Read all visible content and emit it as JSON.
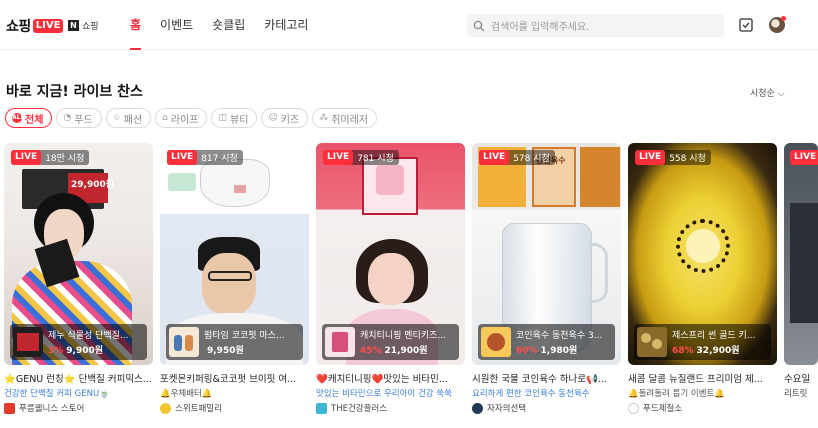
{
  "header": {
    "logo_text": "쇼핑",
    "logo_live": "LIVE",
    "naver_mark": "N",
    "naver_label": "쇼핑",
    "nav": [
      "홈",
      "이벤트",
      "숏클립",
      "카테고리"
    ],
    "search_placeholder": "검색어를 입력해주세요."
  },
  "section": {
    "title": "바로 지금! 라이브 찬스",
    "sort_label": "시청순",
    "chips": [
      {
        "label": "전체",
        "icon": "all-icon",
        "glyph": "ALL"
      },
      {
        "label": "푸드",
        "icon": "food-icon",
        "glyph": "◔"
      },
      {
        "label": "패션",
        "icon": "fashion-icon",
        "glyph": "♧"
      },
      {
        "label": "라이프",
        "icon": "home-icon",
        "glyph": "⌂"
      },
      {
        "label": "뷰티",
        "icon": "beauty-icon",
        "glyph": "◫"
      },
      {
        "label": "키즈",
        "icon": "kids-icon",
        "glyph": "☺"
      },
      {
        "label": "취미레저",
        "icon": "hobby-icon",
        "glyph": "⁂"
      }
    ]
  },
  "cards": [
    {
      "live": "LIVE",
      "viewers": "18만 시청",
      "product_name": "제누 식물성 단백질...",
      "discount": "",
      "price": "9,900원",
      "title": "⭐GENU 런칭⭐ 단백질 커피믹스...",
      "subtitle": "건강한 단백질 커피 GENU🍵",
      "channel": "푸름웰니스 스토어",
      "overlay_price": "29,900원"
    },
    {
      "live": "LIVE",
      "viewers": "817 시청",
      "product_name": "펌타임 코코펏 마스...",
      "discount": "",
      "price": "9,950원",
      "title": "포켓몬키퍼링&코코펏 브이핏 여...",
      "subtitle": "🔔우체배터🔔",
      "channel": "스위트패밀리"
    },
    {
      "live": "LIVE",
      "viewers": "781 시청",
      "product_name": "캐치티니핑 멘티키즈...",
      "discount": "45%",
      "price": "21,900원",
      "title": "❤️캐치티니핑❤️맛있는 비타민...",
      "subtitle": "맛있는 비타민으로 우리아이 건강 쑥쑥",
      "channel": "THE건강플러스"
    },
    {
      "live": "LIVE",
      "viewers": "578 시청",
      "product_name": "코인육수 동천육수 3...",
      "discount": "60%",
      "price": "1,980원",
      "title": "시원한 국물 코인육수 하나로📢...",
      "subtitle": "요리하게 편한 코인육수 동천육수",
      "channel": "자자의선택",
      "overlay_label": "동천육수"
    },
    {
      "live": "LIVE",
      "viewers": "558 시청",
      "product_name": "제스프리 썬 골드 키...",
      "discount": "68%",
      "price": "32,900원",
      "title": "새콤 달콤 뉴질랜드 프리미엄 제...",
      "subtitle": "🔔돌려돌려 룹기 이벤트🔔",
      "channel": "푸드제철소"
    },
    {
      "live": "LIVE",
      "viewers": "",
      "product_name": "",
      "discount": "",
      "price": "",
      "title": "수요일",
      "subtitle": "",
      "channel": "리트릿"
    }
  ]
}
